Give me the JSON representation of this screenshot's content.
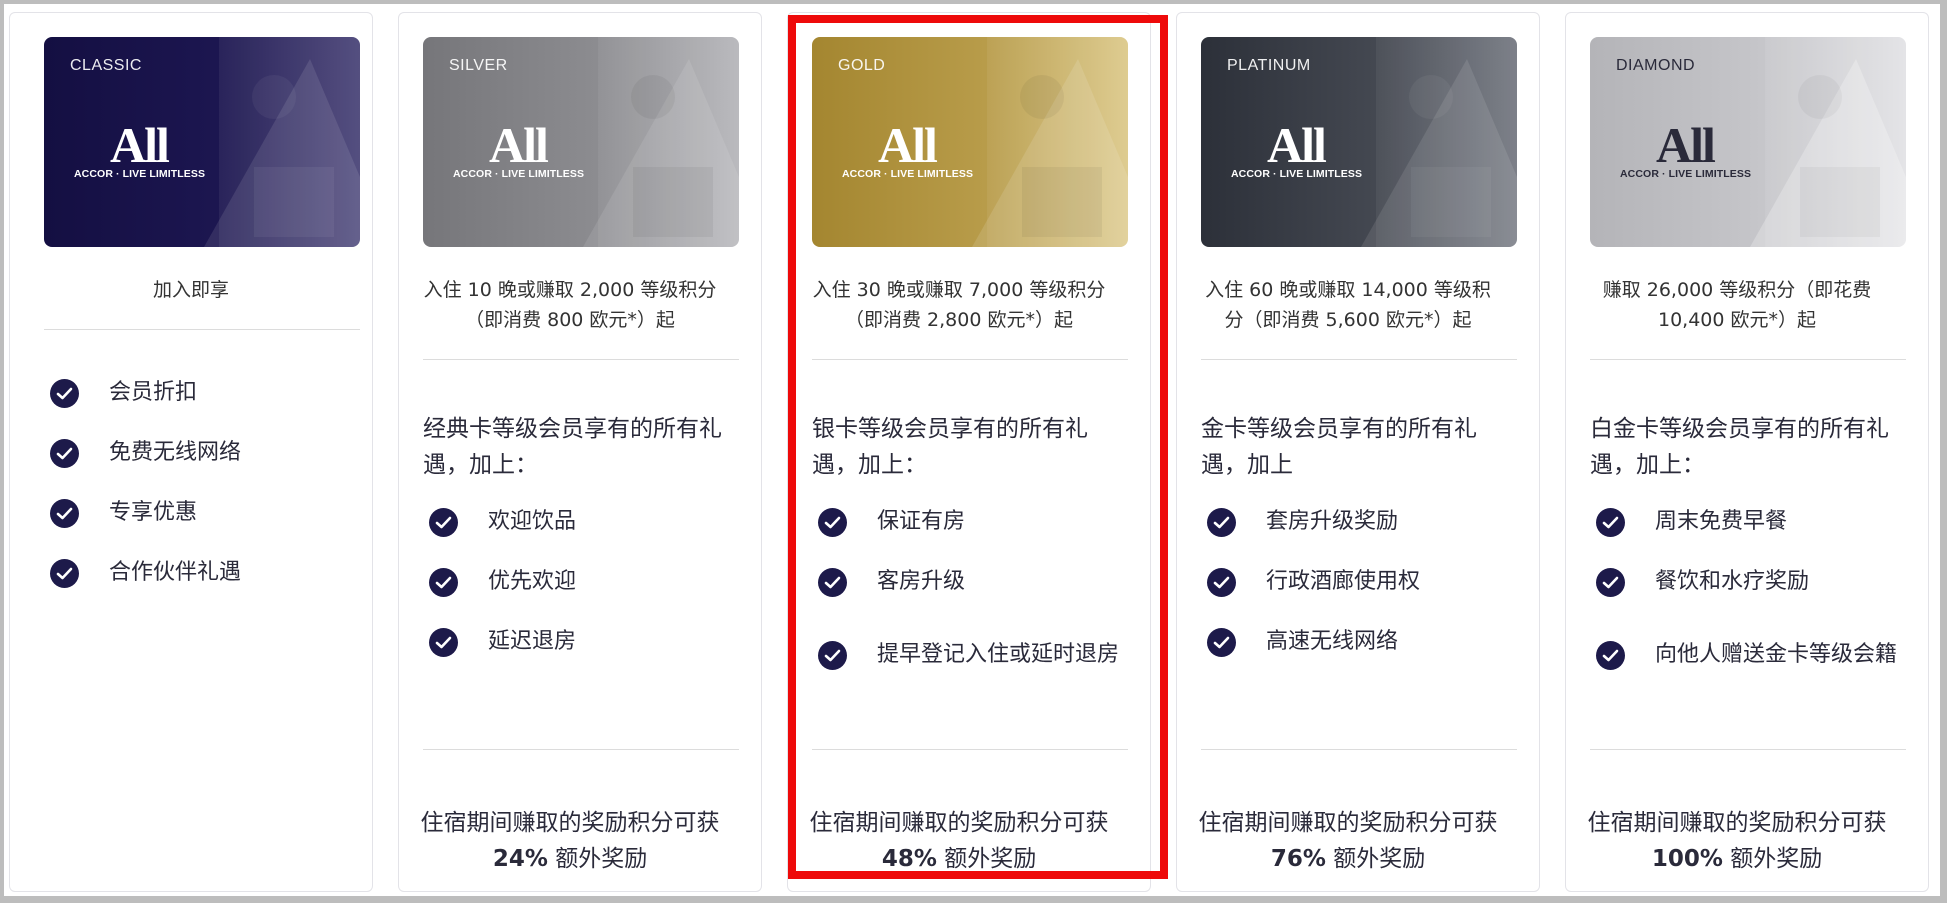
{
  "tiers": [
    {
      "name": "CLASSIC",
      "logo_main": "All",
      "logo_sub": "ACCOR · LIVE LIMITLESS",
      "card_color_from": "#140f42",
      "card_color_to": "#3d3670",
      "requirement_lines": [
        "加入即享"
      ],
      "intro": "",
      "benefits": [
        "会员折扣",
        "免费无线网络",
        "专享优惠",
        "合作伙伴礼遇"
      ],
      "bonus_line1": "",
      "bonus_value": "",
      "bonus_suffix": ""
    },
    {
      "name": "SILVER",
      "logo_main": "All",
      "logo_sub": "ACCOR · LIVE LIMITLESS",
      "card_color_from": "#7a7a7e",
      "card_color_to": "#b0b0b4",
      "requirement_lines": [
        "入住 10 晚或赚取 2,000 等级积分",
        "（即消费 800 欧元*）起"
      ],
      "intro": "经典卡等级会员享有的所有礼遇，加上：",
      "benefits": [
        "欢迎饮品",
        "优先欢迎",
        "延迟退房"
      ],
      "bonus_line1": "住宿期间赚取的奖励积分可获",
      "bonus_value": "24%",
      "bonus_suffix": "额外奖励"
    },
    {
      "name": "GOLD",
      "logo_main": "All",
      "logo_sub": "ACCOR · LIVE LIMITLESS",
      "card_color_from": "#a88a32",
      "card_color_to": "#d8c37e",
      "requirement_lines": [
        "入住 30 晚或赚取 7,000 等级积分",
        "（即消费 2,800 欧元*）起"
      ],
      "intro": "银卡等级会员享有的所有礼遇，加上：",
      "benefits": [
        "保证有房",
        "客房升级",
        "提早登记入住或延时退房"
      ],
      "bonus_line1": "住宿期间赚取的奖励积分可获",
      "bonus_value": "48%",
      "bonus_suffix": "额外奖励"
    },
    {
      "name": "PLATINUM",
      "logo_main": "All",
      "logo_sub": "ACCOR · LIVE LIMITLESS",
      "card_color_from": "#30343d",
      "card_color_to": "#6d717a",
      "requirement_lines": [
        "入住 60 晚或赚取 14,000 等级积",
        "分（即消费 5,600 欧元*）起"
      ],
      "intro": "金卡等级会员享有的所有礼遇，加上",
      "benefits": [
        "套房升级奖励",
        "行政酒廊使用权",
        "高速无线网络"
      ],
      "bonus_line1": "住宿期间赚取的奖励积分可获",
      "bonus_value": "76%",
      "bonus_suffix": "额外奖励"
    },
    {
      "name": "DIAMOND",
      "logo_main": "All",
      "logo_sub": "ACCOR · LIVE LIMITLESS",
      "card_color_from": "#b8b8bc",
      "card_color_to": "#dcdcdf",
      "requirement_lines": [
        "赚取 26,000 等级积分（即花费",
        "10,400 欧元*）起"
      ],
      "intro": "白金卡等级会员享有的所有礼遇，加上：",
      "benefits": [
        "周末免费早餐",
        "餐饮和水疗奖励",
        "向他人赠送金卡等级会籍"
      ],
      "bonus_line1": "住宿期间赚取的奖励积分可获",
      "bonus_value": "100%",
      "bonus_suffix": "额外奖励"
    }
  ],
  "highlight_color": "#ee0a0a",
  "check_color": "#1d1a4a"
}
